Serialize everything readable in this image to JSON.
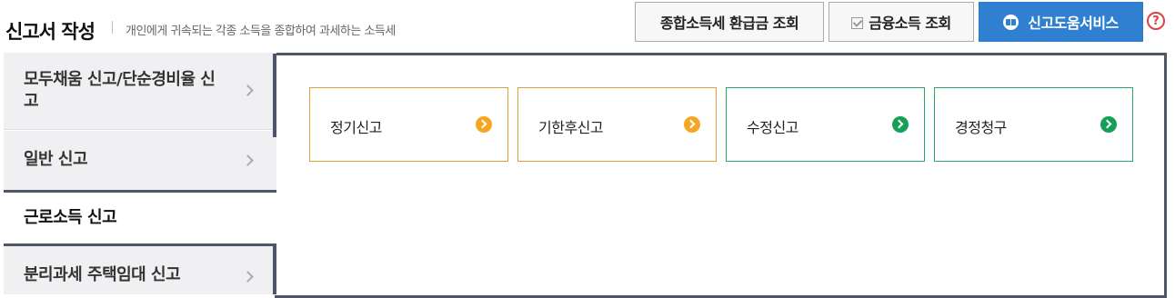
{
  "header": {
    "title": "신고서 작성",
    "description": "개인에게 귀속되는 각종 소득을 종합하여 과세하는 소득세",
    "buttons": {
      "refund_inquiry": "종합소득세 환급금 조회",
      "finance_income": "금융소득 조회",
      "help_service": "신고도움서비스"
    },
    "help_icon": "?"
  },
  "sidebar": {
    "items": [
      {
        "label": "모두채움 신고/단순경비율 신고",
        "active": false
      },
      {
        "label": "일반 신고",
        "active": false
      },
      {
        "label": "근로소득 신고",
        "active": true
      },
      {
        "label": "분리과세 주택임대 신고",
        "active": false
      }
    ]
  },
  "cards": [
    {
      "label": "정기신고",
      "color": "#f5a623"
    },
    {
      "label": "기한후신고",
      "color": "#f5a623"
    },
    {
      "label": "수정신고",
      "color": "#15a057"
    },
    {
      "label": "경정청구",
      "color": "#15a057"
    }
  ],
  "colors": {
    "primary": "#2f80d0",
    "frame": "#4d5566",
    "orange": "#f5a623",
    "green": "#15a057",
    "help": "#e04040"
  },
  "icons": [
    "check-icon",
    "book-icon",
    "question-circle-icon",
    "chevron-right-icon",
    "arrow-circle-right-icon"
  ]
}
